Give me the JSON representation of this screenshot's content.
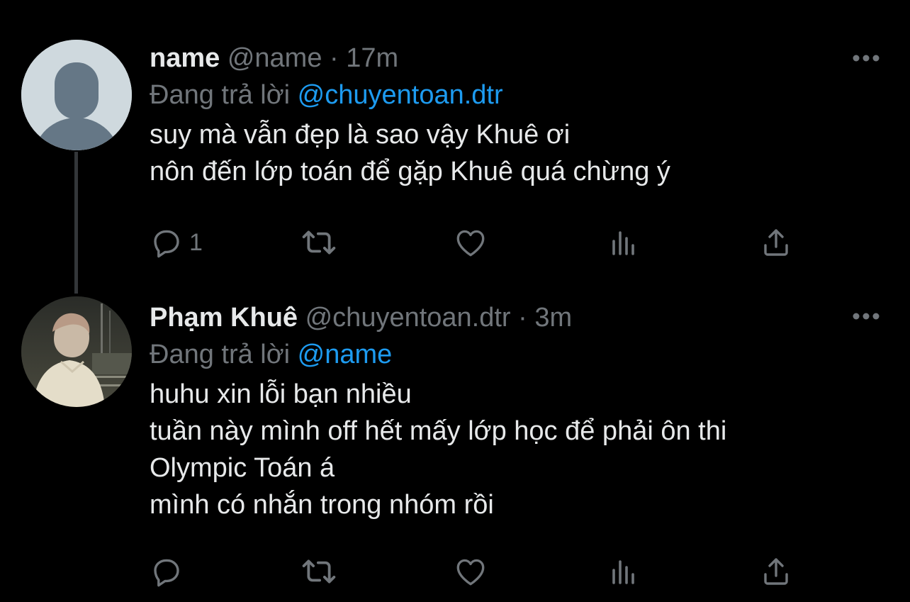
{
  "tweets": [
    {
      "display_name": "name",
      "handle": "@name",
      "separator": "·",
      "time": "17m",
      "reply_prefix": "Đang trả lời",
      "reply_to": "@chuyentoan.dtr",
      "body_lines": [
        "suy mà vẫn đẹp là sao vậy Khuê ơi",
        "nôn đến lớp toán để gặp Khuê quá chừng ý"
      ],
      "reply_count": "1",
      "avatar": "default-avatar-icon"
    },
    {
      "display_name": "Phạm Khuê",
      "handle": "@chuyentoan.dtr",
      "separator": "·",
      "time": "3m",
      "reply_prefix": "Đang trả lời",
      "reply_to": "@name",
      "body_lines": [
        "huhu xin lỗi bạn nhiều",
        "tuần này mình off hết mấy lớp học để phải ôn thi",
        "Olympic Toán á",
        "mình có nhắn trong nhóm rồi"
      ],
      "reply_count": "",
      "avatar": "profile-photo"
    }
  ],
  "icons": {
    "more": "more-horizontal-icon",
    "reply": "reply-icon",
    "retweet": "retweet-icon",
    "like": "like-icon",
    "views": "views-icon",
    "share": "share-icon"
  },
  "colors": {
    "background": "#000000",
    "text_primary": "#e7e9ea",
    "text_secondary": "#71767b",
    "accent": "#1d9bf0",
    "thread_line": "#333639",
    "default_avatar_bg": "#cfd9de",
    "default_avatar_fg": "#657786"
  }
}
